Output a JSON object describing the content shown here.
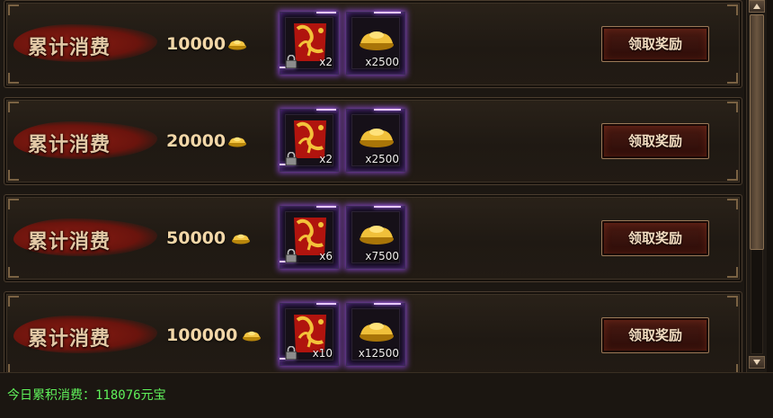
{
  "colors": {
    "banner_red": "#6a140d",
    "status_green": "#5ff05a",
    "epic_glow": "#a050ff",
    "gold_text": "#f2d7a8"
  },
  "rows": [
    {
      "label": "累计消费",
      "amount": "10000",
      "currency_icon": "gold-ingot-icon",
      "rewards": [
        {
          "icon": "fortune-charm-icon",
          "qty": "x2",
          "locked": true
        },
        {
          "icon": "gold-ingot-icon",
          "qty": "x2500",
          "locked": false
        }
      ],
      "button": "领取奖励"
    },
    {
      "label": "累计消费",
      "amount": "20000",
      "currency_icon": "gold-ingot-icon",
      "rewards": [
        {
          "icon": "fortune-charm-icon",
          "qty": "x2",
          "locked": true
        },
        {
          "icon": "gold-ingot-icon",
          "qty": "x2500",
          "locked": false
        }
      ],
      "button": "领取奖励"
    },
    {
      "label": "累计消费",
      "amount": "50000",
      "currency_icon": "gold-ingot-icon",
      "rewards": [
        {
          "icon": "fortune-charm-icon",
          "qty": "x6",
          "locked": true
        },
        {
          "icon": "gold-ingot-icon",
          "qty": "x7500",
          "locked": false
        }
      ],
      "button": "领取奖励"
    },
    {
      "label": "累计消费",
      "amount": "100000",
      "currency_icon": "gold-ingot-icon",
      "rewards": [
        {
          "icon": "fortune-charm-icon",
          "qty": "x10",
          "locked": true
        },
        {
          "icon": "gold-ingot-icon",
          "qty": "x12500",
          "locked": false
        }
      ],
      "button": "领取奖励"
    }
  ],
  "status": {
    "text": "今日累积消费：118076元宝"
  }
}
